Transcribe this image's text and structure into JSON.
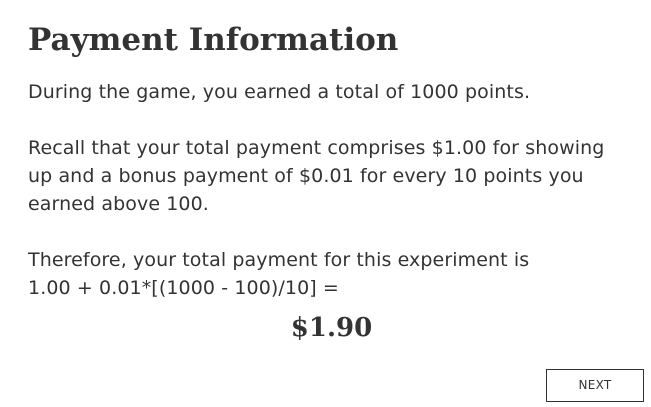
{
  "page": {
    "title": "Payment Information",
    "earned_text": "During the game, you earned a total of 1000 points.",
    "recall_line1": "Recall that your total payment comprises $1.00 for showing",
    "recall_line2": "up and a bonus payment of $0.01 for every 10 points you",
    "recall_line3": "earned above 100.",
    "therefore_line1": "Therefore, your total payment for this experiment is",
    "therefore_line2": "1.00 + 0.01*[(1000 - 100)/10] =",
    "total_amount": "$1.90"
  },
  "actions": {
    "next_label": "NEXT"
  }
}
